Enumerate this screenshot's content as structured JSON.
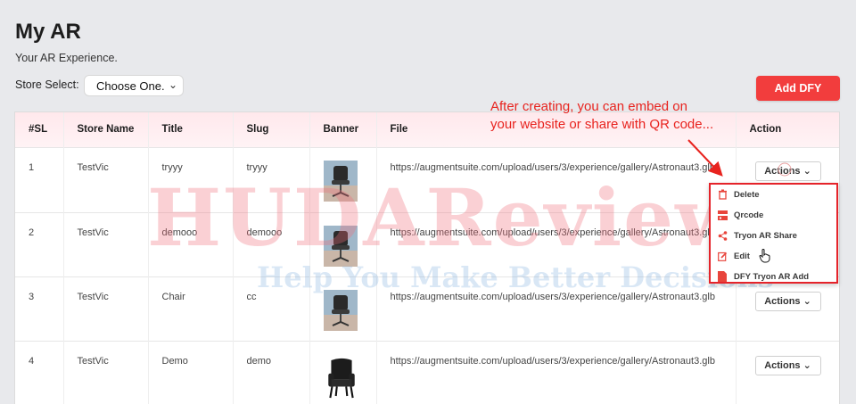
{
  "header": {
    "title": "My AR",
    "subtitle": "Your AR Experience."
  },
  "store_select": {
    "label": "Store Select:",
    "value": "Choose One."
  },
  "add_button": "Add DFY",
  "annotation": {
    "line1": "After creating, you can embed on",
    "line2": "your website or share with QR code..."
  },
  "table": {
    "headers": [
      "#SL",
      "Store Name",
      "Title",
      "Slug",
      "Banner",
      "File",
      "Action"
    ],
    "rows": [
      {
        "sl": "1",
        "store": "TestVic",
        "title": "tryyy",
        "slug": "tryyy",
        "file": "https://augmentsuite.com/upload/users/3/experience/gallery/Astronaut3.glb",
        "action": "Actions"
      },
      {
        "sl": "2",
        "store": "TestVic",
        "title": "demooo",
        "slug": "demooo",
        "file": "https://augmentsuite.com/upload/users/3/experience/gallery/Astronaut3.glb",
        "action": "Actions"
      },
      {
        "sl": "3",
        "store": "TestVic",
        "title": "Chair",
        "slug": "cc",
        "file": "https://augmentsuite.com/upload/users/3/experience/gallery/Astronaut3.glb",
        "action": "Actions"
      },
      {
        "sl": "4",
        "store": "TestVic",
        "title": "Demo",
        "slug": "demo",
        "file": "https://augmentsuite.com/upload/users/3/experience/gallery/Astronaut3.glb",
        "action": "Actions"
      }
    ]
  },
  "dropdown": {
    "items": [
      {
        "label": "Delete",
        "icon": "trash-icon"
      },
      {
        "label": "Qrcode",
        "icon": "qrcode-icon"
      },
      {
        "label": "Tryon AR Share",
        "icon": "share-icon"
      },
      {
        "label": "Edit",
        "icon": "edit-icon"
      },
      {
        "label": "DFY Tryon AR Add",
        "icon": "file-icon"
      }
    ]
  },
  "watermark": {
    "main": "HUDAReview",
    "sub": "Help You Make Better Decisions"
  },
  "colors": {
    "accent": "#f23d3d",
    "annotation": "#e8231e",
    "header_bg": "#ffe8ec"
  }
}
